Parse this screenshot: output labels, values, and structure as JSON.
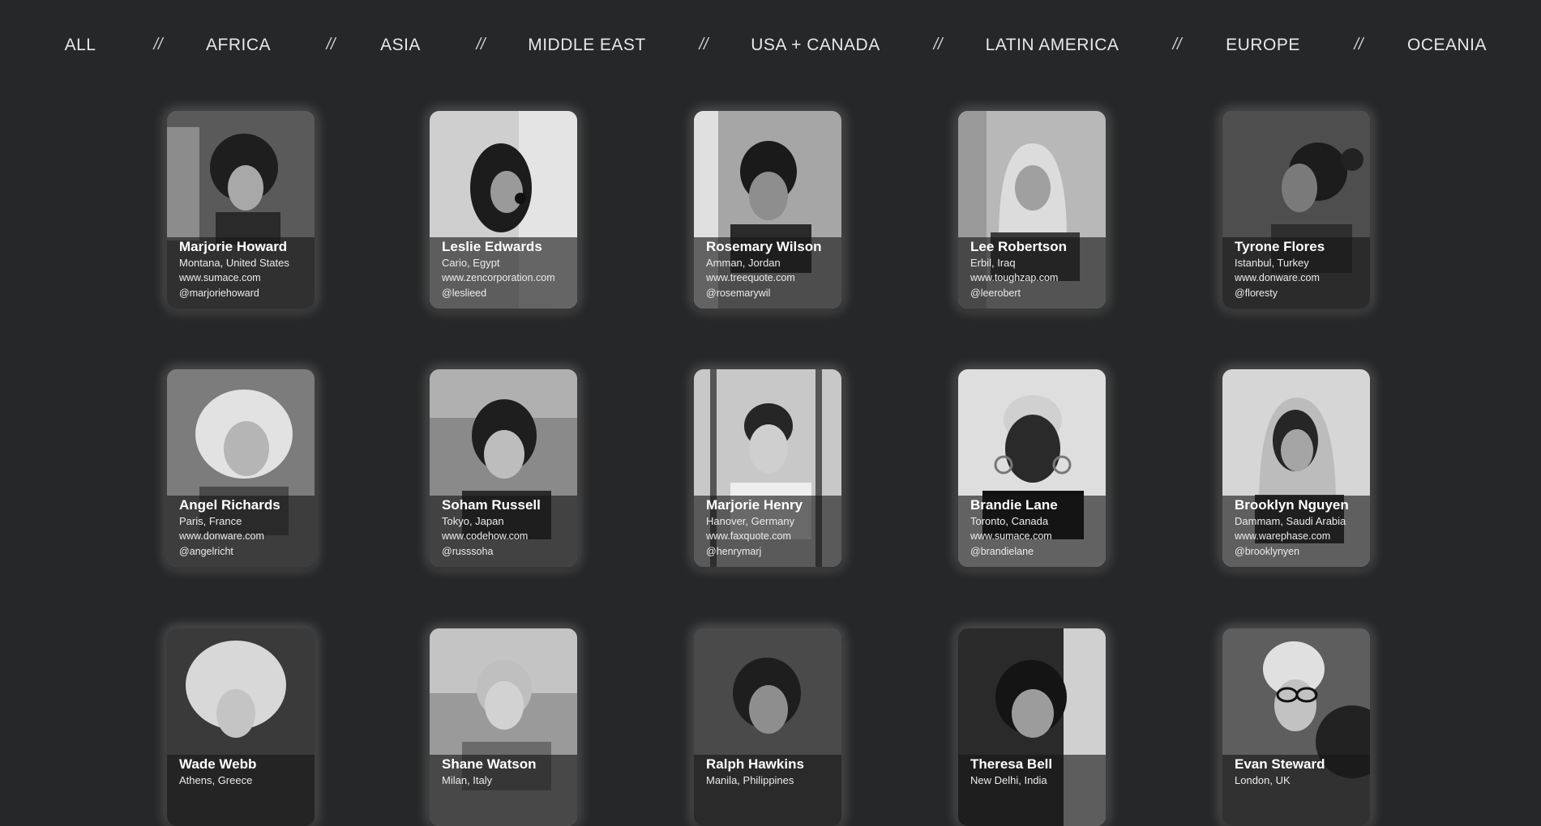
{
  "nav": {
    "items": [
      "ALL",
      "AFRICA",
      "ASIA",
      "MIDDLE EAST",
      "USA + CANADA",
      "LATIN AMERICA",
      "EUROPE",
      "OCEANIA"
    ],
    "separator": "//"
  },
  "cards": [
    {
      "name": "Marjorie Howard",
      "location": "Montana, United States",
      "website": "www.sumace.com",
      "handle": "@marjoriehoward"
    },
    {
      "name": "Leslie Edwards",
      "location": "Cario, Egypt",
      "website": "www.zencorporation.com",
      "handle": "@leslieed"
    },
    {
      "name": "Rosemary Wilson",
      "location": "Amman, Jordan",
      "website": "www.treequote.com",
      "handle": "@rosemarywil"
    },
    {
      "name": "Lee Robertson",
      "location": "Erbil, Iraq",
      "website": "www.toughzap.com",
      "handle": "@leerobert"
    },
    {
      "name": "Tyrone Flores",
      "location": "Istanbul, Turkey",
      "website": "www.donware.com",
      "handle": "@floresty"
    },
    {
      "name": "Angel Richards",
      "location": "Paris, France",
      "website": "www.donware.com",
      "handle": "@angelricht"
    },
    {
      "name": "Soham Russell",
      "location": "Tokyo, Japan",
      "website": "www.codehow.com",
      "handle": "@russsoha"
    },
    {
      "name": "Marjorie Henry",
      "location": "Hanover, Germany",
      "website": "www.faxquote.com",
      "handle": "@henrymarj"
    },
    {
      "name": "Brandie Lane",
      "location": "Toronto, Canada",
      "website": "www.sumace.com",
      "handle": "@brandielane"
    },
    {
      "name": "Brooklyn Nguyen",
      "location": "Dammam, Saudi Arabia",
      "website": "www.warephase.com",
      "handle": "@brooklynyen"
    },
    {
      "name": "Wade Webb",
      "location": "Athens, Greece",
      "website": "",
      "handle": ""
    },
    {
      "name": "Shane Watson",
      "location": "Milan, Italy",
      "website": "",
      "handle": ""
    },
    {
      "name": "Ralph Hawkins",
      "location": "Manila, Philippines",
      "website": "",
      "handle": ""
    },
    {
      "name": "Theresa Bell",
      "location": "New Delhi, India",
      "website": "",
      "handle": ""
    },
    {
      "name": "Evan Steward",
      "location": "London, UK",
      "website": "",
      "handle": ""
    }
  ],
  "colors": {
    "background": "#262728",
    "nav_text": "#e8e8e8",
    "card_overlay": "rgba(22,22,22,0.62)"
  }
}
